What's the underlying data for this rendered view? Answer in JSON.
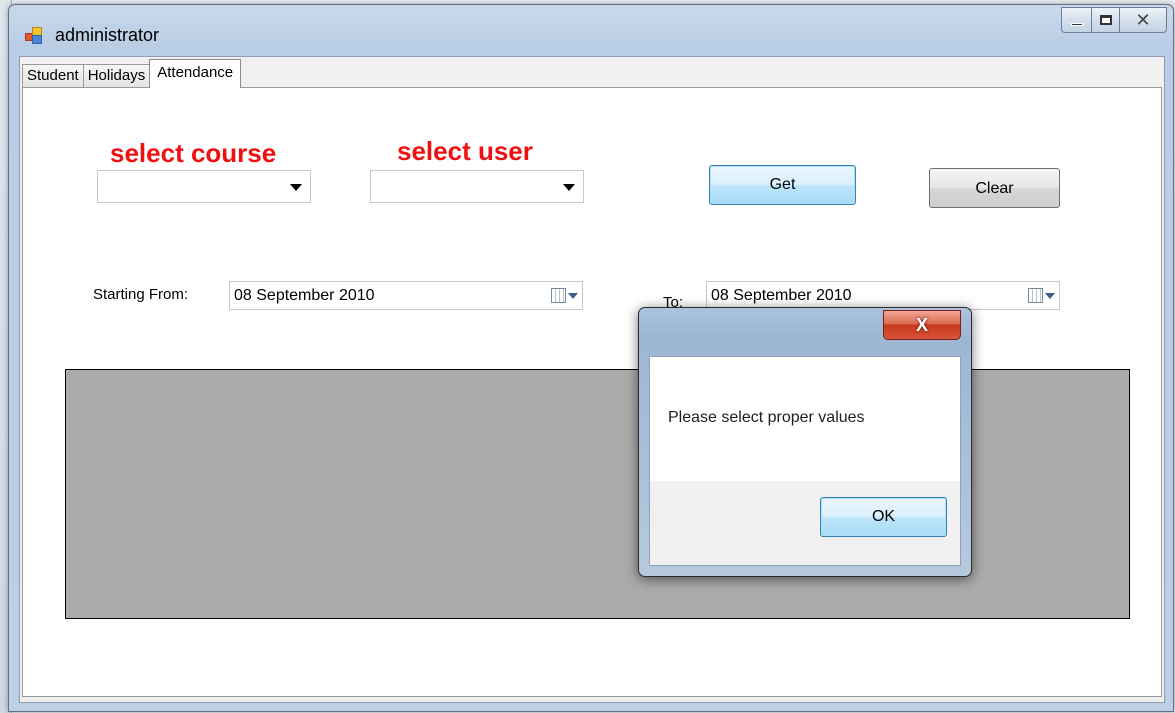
{
  "window": {
    "title": "administrator",
    "icon": "app-icon",
    "controls": {
      "minimize": "minimize-icon",
      "maximize": "maximize-icon",
      "close": "✕"
    }
  },
  "tabs": [
    {
      "label": "Student",
      "active": false
    },
    {
      "label": "Holidays",
      "active": false
    },
    {
      "label": "Attendance",
      "active": true
    }
  ],
  "form": {
    "course_label": "select course",
    "user_label": "select user",
    "course_value": "",
    "user_value": "",
    "get_button": "Get",
    "clear_button": "Clear",
    "start_label": "Starting From:",
    "start_date": "08 September 2010",
    "to_label": "To:",
    "end_date": "08 September 2010",
    "label_color": "#ee1111"
  },
  "dialog": {
    "close": "X",
    "message": "Please select proper values",
    "ok_button": "OK"
  }
}
